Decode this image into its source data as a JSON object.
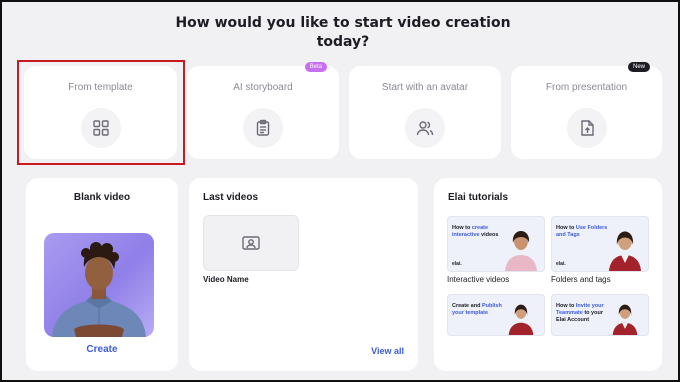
{
  "header": {
    "title": "How would you like to start video creation today?"
  },
  "options": [
    {
      "label": "From template",
      "icon": "grid-icon"
    },
    {
      "label": "AI storyboard",
      "icon": "clipboard-icon",
      "badge": "Beta",
      "badge_color": "#c86ef0"
    },
    {
      "label": "Start with an avatar",
      "icon": "users-icon"
    },
    {
      "label": "From presentation",
      "icon": "file-upload-icon",
      "badge": "New",
      "badge_color": "#1c1c24"
    }
  ],
  "blank_video": {
    "title": "Blank video",
    "create_label": "Create"
  },
  "last_videos": {
    "title": "Last videos",
    "video_name": "Video Name",
    "view_all_label": "View all"
  },
  "tutorials": {
    "title": "Elai tutorials",
    "items": [
      {
        "caption": "Interactive videos",
        "thumb_pre": "How to ",
        "thumb_hl": "create interactive",
        "thumb_post": " videos",
        "brand": "elai."
      },
      {
        "caption": "Folders and tags",
        "thumb_pre": "How to ",
        "thumb_hl": "Use Folders and Tags",
        "thumb_post": "",
        "brand": "elai."
      },
      {
        "caption": "",
        "thumb_pre": "Create and ",
        "thumb_hl": "Publish your template",
        "thumb_post": "",
        "brand": ""
      },
      {
        "caption": "",
        "thumb_pre": "How to ",
        "thumb_hl": "Invite your Teammate",
        "thumb_post": " to your Elai Account",
        "brand": ""
      }
    ]
  },
  "colors": {
    "accent": "#3d5bdb",
    "selection_outline": "#c81a1f",
    "background": "#f1f1f3"
  }
}
